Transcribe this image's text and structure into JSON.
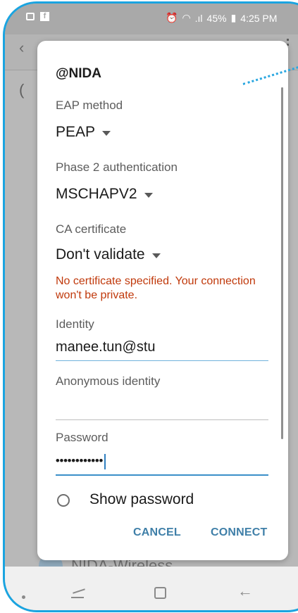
{
  "status_bar": {
    "battery": "45%",
    "time": "4:25 PM",
    "icons": [
      "image-icon",
      "facebook-icon",
      "alarm-icon",
      "wifi-icon",
      "signal-icon",
      "battery-icon"
    ]
  },
  "background": {
    "partial_letter": "(",
    "partial_network_text": "NIDA-Wireless"
  },
  "dialog": {
    "title": "@NIDA",
    "eap_method": {
      "label": "EAP method",
      "value": "PEAP"
    },
    "phase2": {
      "label": "Phase 2 authentication",
      "value": "MSCHAPV2"
    },
    "ca_certificate": {
      "label": "CA certificate",
      "value": "Don't validate"
    },
    "warning": "No certificate specified. Your connection won't be private.",
    "identity": {
      "label": "Identity",
      "value": "manee.tun@stu"
    },
    "anonymous_identity": {
      "label": "Anonymous identity",
      "value": ""
    },
    "password": {
      "label": "Password",
      "value": "••••••••••••"
    },
    "show_password": "Show password",
    "cancel": "CANCEL",
    "connect": "CONNECT"
  },
  "colors": {
    "accent": "#3f7fa8",
    "warning": "#c0390b",
    "frame": "#1aa4e0"
  }
}
